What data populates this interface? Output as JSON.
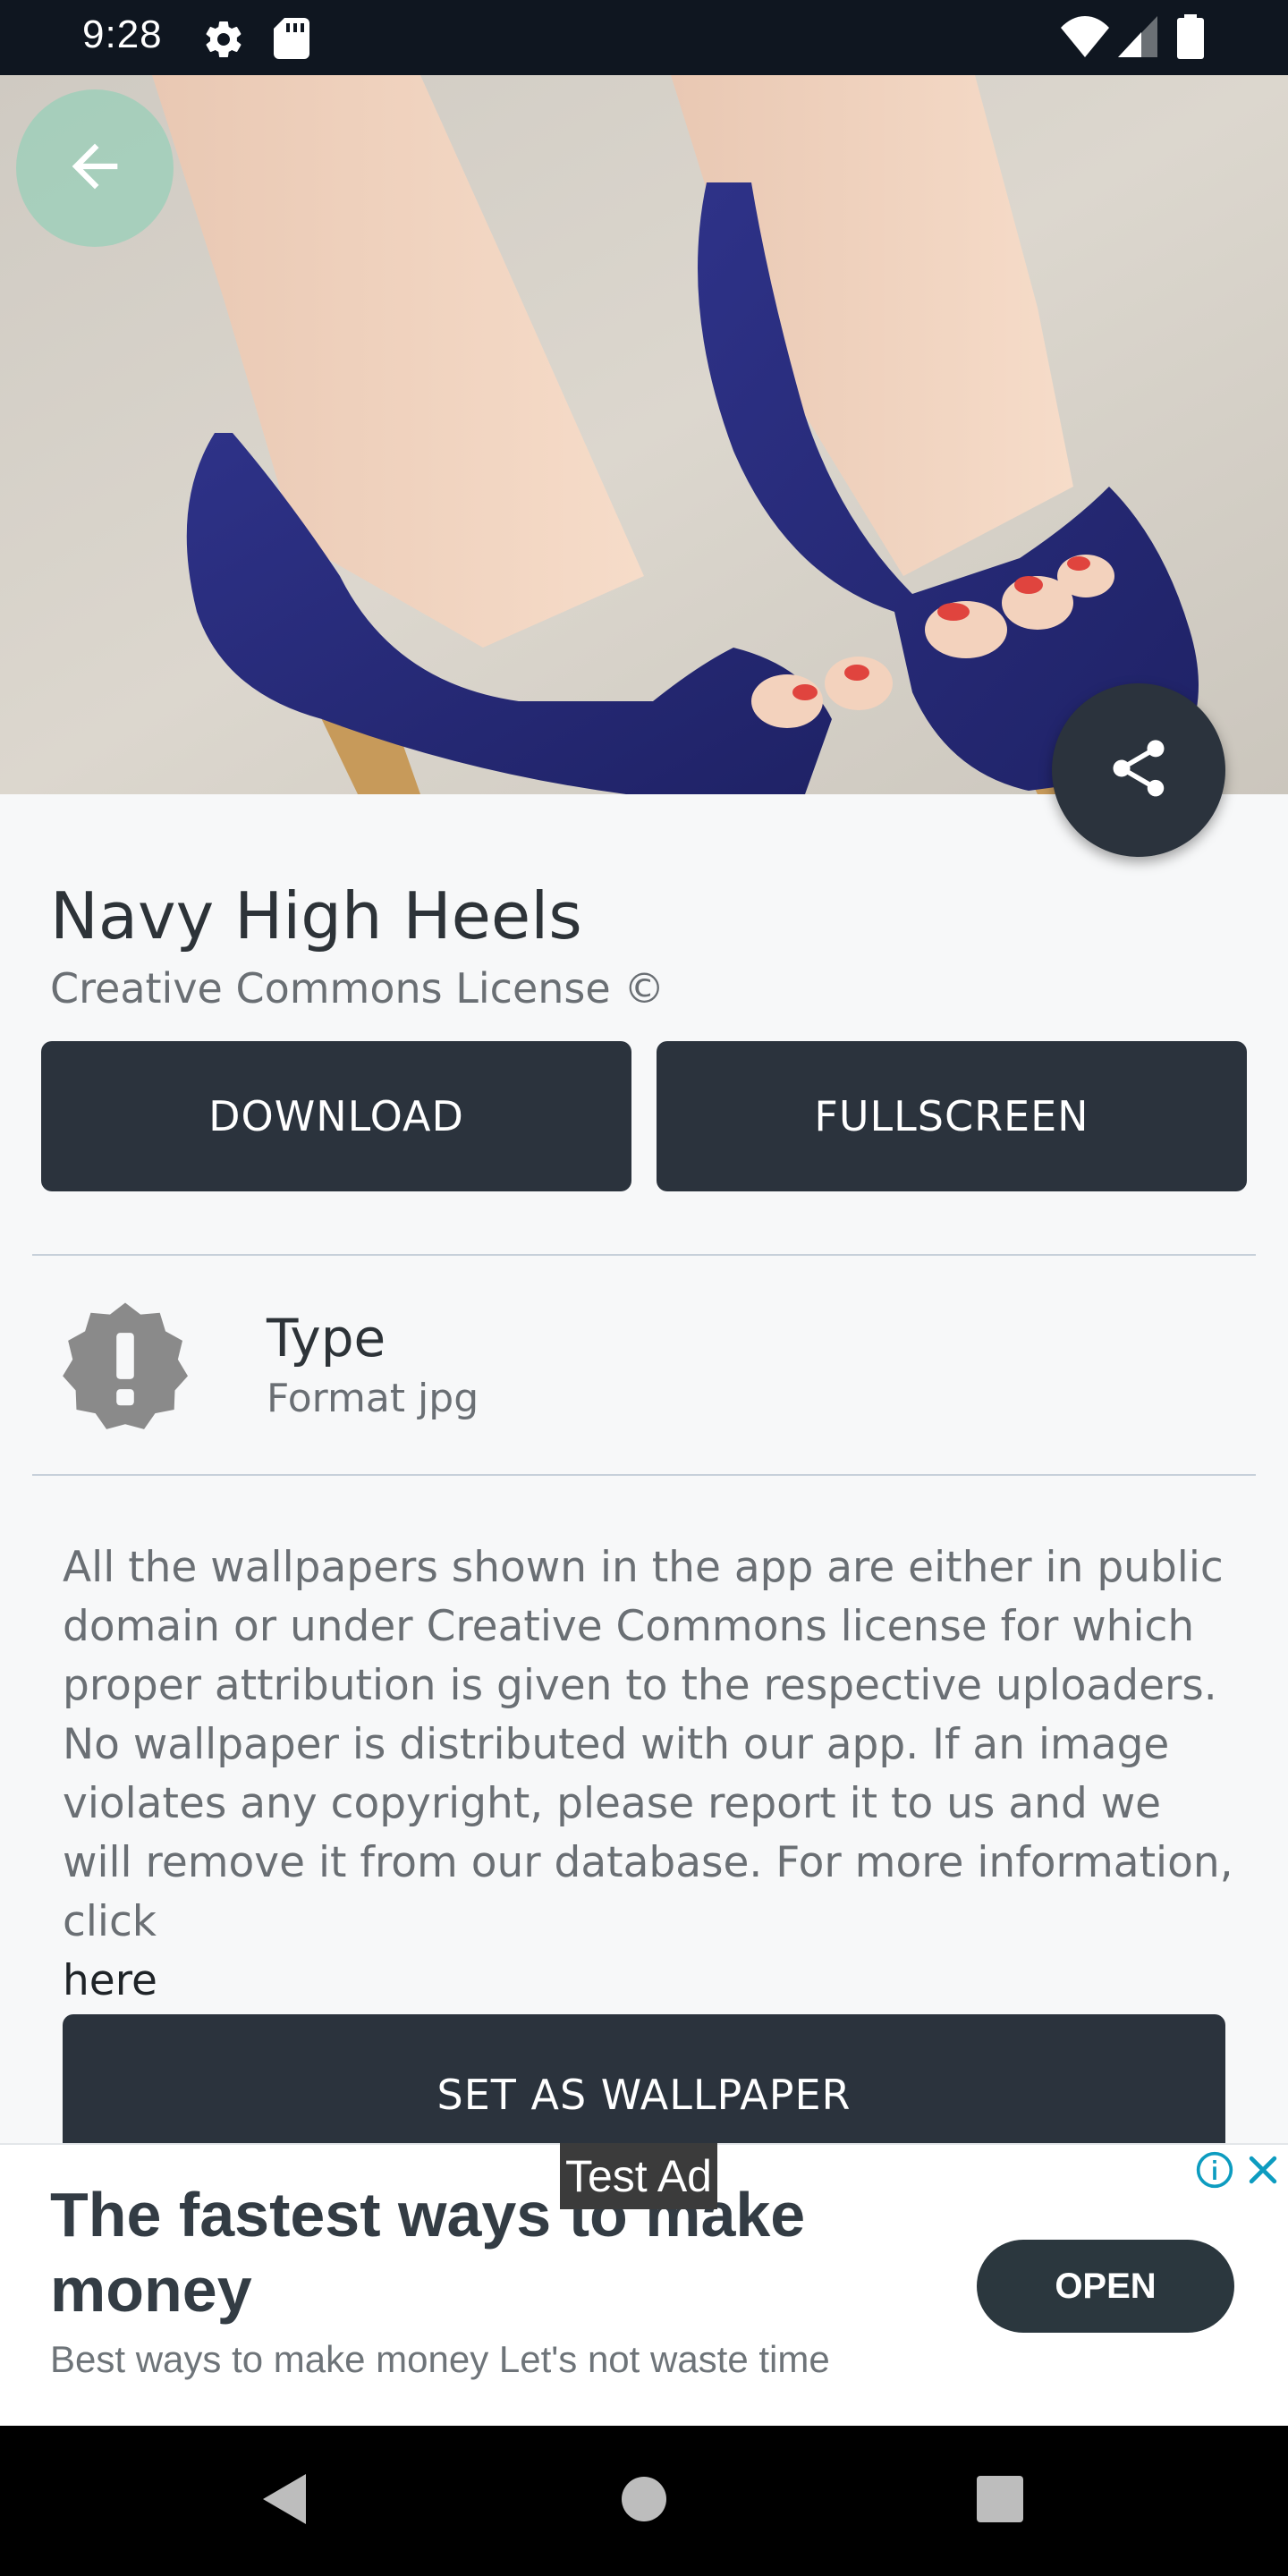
{
  "status_bar": {
    "time": "9:28",
    "icons": [
      "settings-icon",
      "sd-card-icon",
      "wifi-icon",
      "signal-icon",
      "battery-icon"
    ]
  },
  "hero": {
    "image": "navy-high-heels-photo",
    "back_icon": "arrow-back-icon",
    "share_icon": "share-icon"
  },
  "wallpaper": {
    "title": "Navy High Heels",
    "license": "Creative Commons License ©"
  },
  "actions": {
    "download_label": "DOWNLOAD",
    "fullscreen_label": "FULLSCREEN",
    "set_wallpaper_label": "SET AS WALLPAPER"
  },
  "info": {
    "icon": "alert-badge-icon",
    "type_label": "Type",
    "type_value": "Format jpg"
  },
  "disclaimer": {
    "text": "All the wallpapers shown in the app are either in public domain or under Creative Commons license for which proper attribution is given to the respective uploaders. No wallpaper is distributed with our app. If an image violates any copyright, please report it to us and we will remove it from our database. For more information, click",
    "link_label": "here"
  },
  "ad": {
    "tag": "Test Ad",
    "headline": "The fastest ways to make money",
    "body": "Best ways to make money Let's not waste time",
    "cta_label": "OPEN",
    "info_icon": "info-icon",
    "close_icon": "close-icon"
  },
  "nav_bar": {
    "icons": [
      "nav-back-icon",
      "nav-home-icon",
      "nav-recents-icon"
    ]
  },
  "colors": {
    "button_dark": "#2b333d",
    "status_bar": "#0f1620",
    "back_button_bg": "#98cfb8",
    "shoe_navy": "#2a2c7a",
    "divider": "#c7d0da"
  }
}
